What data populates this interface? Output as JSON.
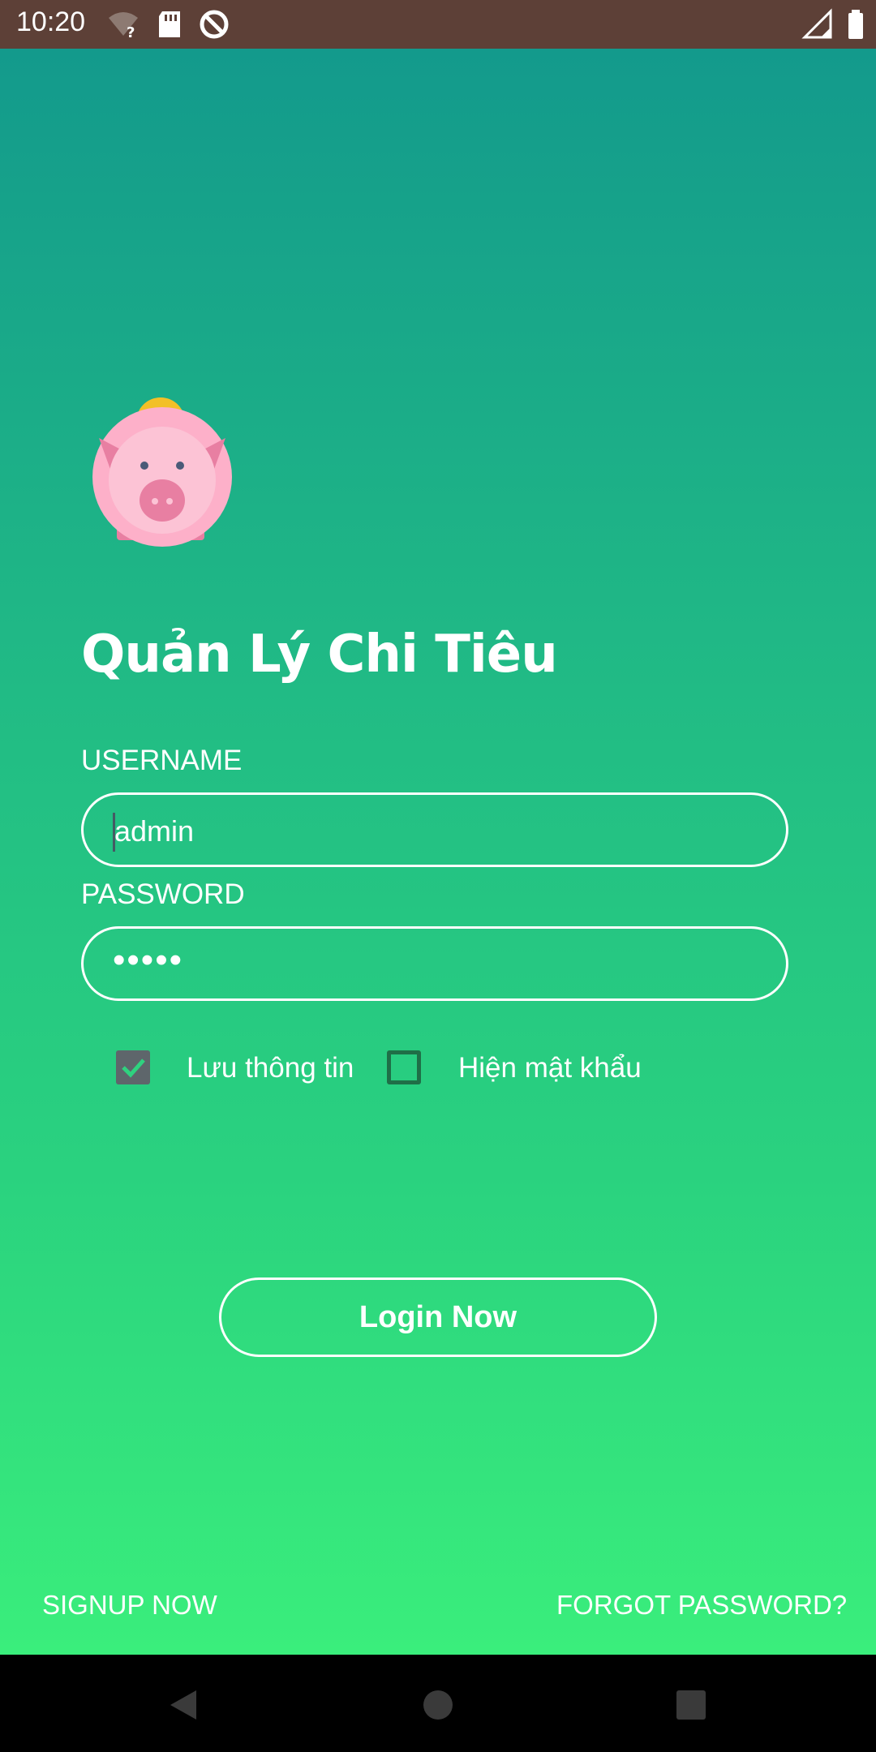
{
  "status_bar": {
    "time": "10:20",
    "icons": [
      "wifi-unknown-icon",
      "sd-card-icon",
      "data-saver-icon",
      "signal-icon",
      "battery-icon"
    ]
  },
  "app": {
    "logo": "piggy-bank-icon",
    "title": "Quản Lý Chi Tiêu"
  },
  "form": {
    "username_label": "USERNAME",
    "username_value": "admin",
    "password_label": "PASSWORD",
    "password_value": "•••••",
    "remember_label": "Lưu thông tin",
    "remember_checked": true,
    "show_password_label": "Hiện mật khẩu",
    "show_password_checked": false,
    "login_button": "Login Now"
  },
  "links": {
    "signup": "SIGNUP NOW",
    "forgot": "FORGOT PASSWORD?"
  },
  "nav": {
    "back": "back-icon",
    "home": "home-icon",
    "recents": "recents-icon"
  },
  "colors": {
    "status_bar": "#5d4037",
    "gradient_top": "#139a8c",
    "gradient_bottom": "#3aee7c",
    "checkbox_checked": "#5e666b",
    "checkmark": "#2fd27f"
  }
}
